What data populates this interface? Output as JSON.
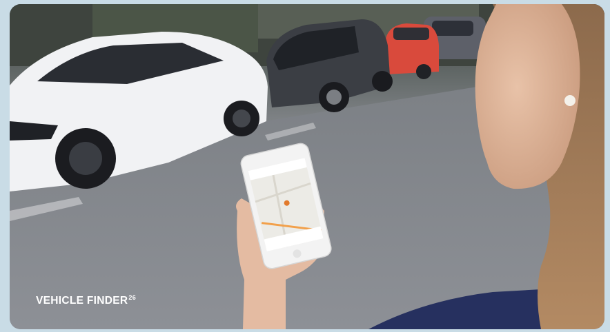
{
  "caption": {
    "title": "VEHICLE FINDER",
    "footnote": "26"
  },
  "colors": {
    "frame": "#c9dce6",
    "caption_text": "#ffffff",
    "white_car": "#f1f2f4",
    "red_car": "#d94a3c",
    "dark_car": "#3b3e44",
    "map_route": "#f2a04a",
    "sweater": "#26305f"
  }
}
